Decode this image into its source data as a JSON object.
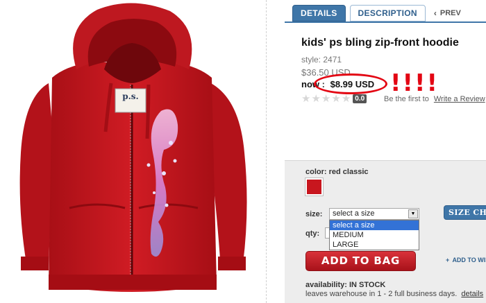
{
  "tabs": {
    "details": "DETAILS",
    "description": "DESCRIPTION",
    "prev": "PREV"
  },
  "product": {
    "title": "kids' ps bling zip-front hoodie",
    "style": "style: 2471",
    "was_price": "$36.50 USD",
    "now_label": "now",
    "now_sep": ":",
    "now_price": "$8.99 USD",
    "annotation": "!!!!",
    "image_logo": "p.s."
  },
  "rating": {
    "value": "0.0",
    "prompt": "Be the first to",
    "link": "Write a Review"
  },
  "options": {
    "color_label": "color:",
    "color_value": "red classic",
    "swatch_color": "#c8161e",
    "size_label": "size:",
    "size_selected": "select a size",
    "size_options": [
      "select a size",
      "MEDIUM",
      "LARGE"
    ],
    "size_chart": "SIZE CHART",
    "qty_label": "qty:"
  },
  "actions": {
    "add_to_bag": "ADD TO BAG",
    "add_to_wishlist": "ADD TO WISHLIST"
  },
  "availability": {
    "label": "availability:",
    "status": "IN STOCK",
    "leaves": "leaves warehouse in 1 - 2 full business days.",
    "details_link": "details"
  },
  "colors": {
    "accent_blue": "#3f76a8",
    "highlight_red": "#e30613",
    "hoodie_red": "#c8161e"
  }
}
